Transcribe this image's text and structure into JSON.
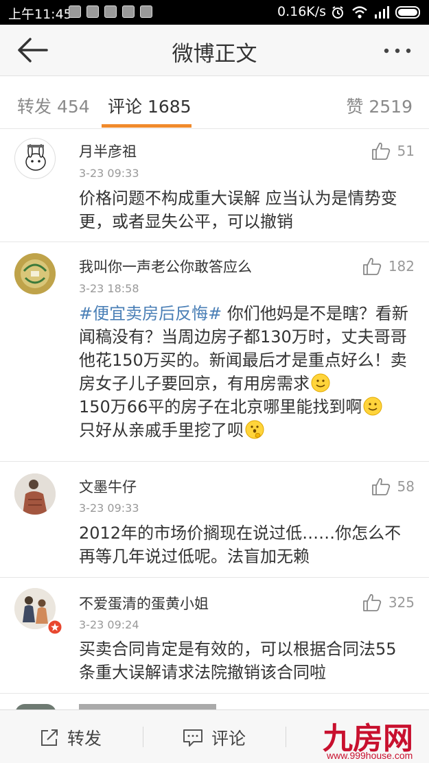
{
  "status_bar": {
    "time": "上午11:45",
    "network_speed": "0.16K/s",
    "icons": [
      "alarm-icon",
      "wifi-icon",
      "signal-icon",
      "battery-icon"
    ]
  },
  "header": {
    "title": "微博正文"
  },
  "tabs": [
    {
      "label": "转发 454",
      "active": false
    },
    {
      "label": "评论 1685",
      "active": true
    },
    {
      "label": "赞 2519",
      "active": false
    }
  ],
  "comments": [
    {
      "name": "月半彦祖",
      "time": "3-23 09:33",
      "likes": "51",
      "text": "价格问题不构成重大误解 应当认为是情势变更，或者显失公平，可以撤销"
    },
    {
      "name": "我叫你一声老公你敢答应么",
      "time": "3-23 18:58",
      "likes": "182",
      "topic": "#便宜卖房后反悔#",
      "text_a": " 你们他妈是不是瞎？看新闻稿没有？当周边房子都130万时，丈夫哥哥他花150万买的。新闻最后才是重点好么！卖房女子儿子要回京，有用房需求",
      "text_b": "150万66平的房子在北京哪里能找到啊",
      "text_c": "只好从亲戚手里挖了呗"
    },
    {
      "name": "文墨牛仔",
      "time": "3-23 09:33",
      "likes": "58",
      "text": "2012年的市场价搁现在说过低……你怎么不再等几年说过低呢。法盲加无赖"
    },
    {
      "name": "不爱蛋清的蛋黄小姐",
      "time": "3-23 09:24",
      "likes": "325",
      "text": "买卖合同肯定是有效的，可以根据合同法55条重大误解请求法院撤销该合同啦"
    }
  ],
  "bottom_bar": {
    "repost_label": "转发",
    "comment_label": "评论"
  },
  "watermark": {
    "main": "九房网",
    "sub": "www.999house.com"
  },
  "colors": {
    "accent": "#f08a2c",
    "topic": "#4a7fb6",
    "watermark": "#c8102e"
  }
}
